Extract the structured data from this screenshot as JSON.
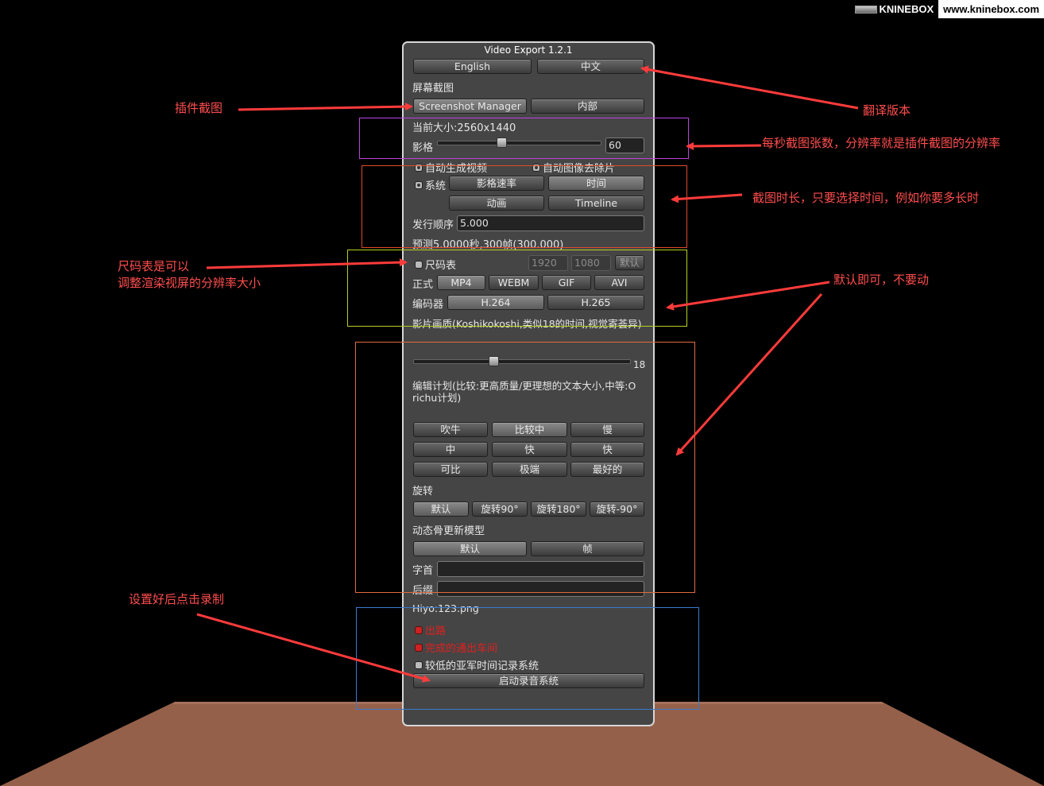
{
  "watermark": {
    "brand": "KNINEBOX",
    "url": "www.kninebox.com"
  },
  "panel": {
    "title": "Video Export 1.2.1",
    "lang_buttons": [
      "English",
      "中文"
    ],
    "screenshot_label": "屏幕截图",
    "screenshot_buttons": [
      "Screenshot Manager",
      "内部"
    ],
    "current_size": "当前大小:2560x1440",
    "fps_label": "影格",
    "fps_value": "60",
    "fps_fraction": 0.38,
    "auto_video": "自动生成视频",
    "auto_delete": "自动图像去除片",
    "system": "系统",
    "mode_buttons": [
      "影格速率",
      "时间",
      "动画",
      "Timeline"
    ],
    "order_label": "发行顺序",
    "order_value": "5.000",
    "estimate": "预测5.0000秒,300帧(300.000)",
    "ruler": "尺码表",
    "ruler_w": "1920",
    "ruler_h": "1080",
    "ruler_default": "默认",
    "format_label": "正式",
    "formats": [
      "MP4",
      "WEBM",
      "GIF",
      "AVI"
    ],
    "codec_label": "编码器",
    "codecs": [
      "H.264",
      "H.265"
    ],
    "quality_label": "影片画质(Koshikokoshi,类似18的时间,视觉寄荟异)",
    "quality_value": "18",
    "quality_fraction": 0.36,
    "plan_label": "编辑计划(比较:更高质量/更理想的文本大小,中等:O richu计划)",
    "presets": [
      "吹牛",
      "比较中",
      "慢",
      "中",
      "快",
      "快",
      "可比",
      "极端",
      "最好的"
    ],
    "rotate_label": "旋转",
    "rotations": [
      "默认",
      "旋转90°",
      "旋转180°",
      "旋转-90°"
    ],
    "bone_label": "动态骨更新模型",
    "bone_buttons": [
      "默认",
      "帧"
    ],
    "prefix_label": "字首",
    "suffix_label": "后缀",
    "filename": "Hiyo:123.png",
    "red_toggle_1": "出路",
    "red_toggle_2": "完成的通出车间",
    "low_time": "较低的亚军时间记录系统",
    "start_button": "启动录音系统"
  },
  "annotations": {
    "plugin_screenshot": "插件截图",
    "translation": "翻译版本",
    "fps_note": "每秒截图张数，分辨率就是插件截图的分辨率",
    "duration_note": "截图时长，只要选择时间，例如你要多长时",
    "ruler_note_1": "尺码表是可以",
    "ruler_note_2": "调整渲染视屏的分辨率大小",
    "default_note": "默认即可，不要动",
    "record_note": "设置好后点击录制"
  },
  "colors": {
    "annotation": "#ff4d4d",
    "floor": "#94604a",
    "panel": "#454545"
  }
}
